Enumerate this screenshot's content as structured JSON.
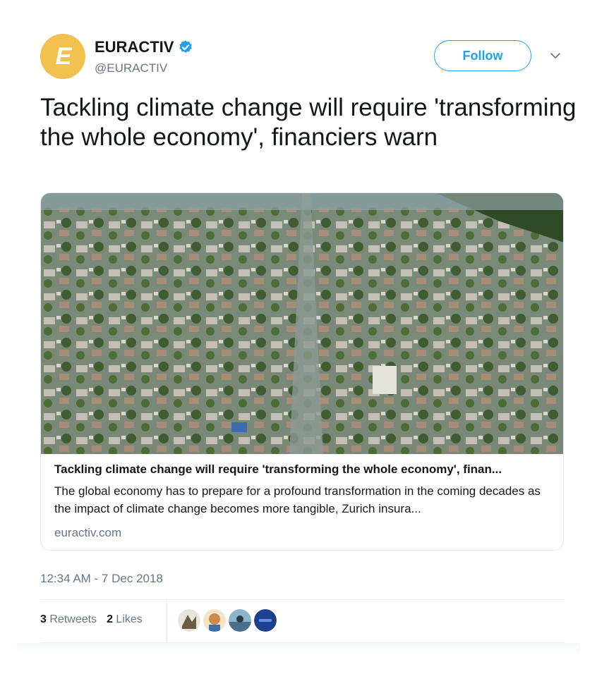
{
  "account": {
    "display_name": "EURACTIV",
    "handle": "@EURACTIV",
    "avatar_letter": "E",
    "verified": true,
    "avatar_color": "#f2c14e"
  },
  "actions": {
    "follow_label": "Follow"
  },
  "tweet": {
    "text": "Tackling climate change will require 'transforming the whole economy', financiers warn"
  },
  "card": {
    "title": "Tackling climate change will require 'transforming the whole economy', finan...",
    "description": "The global economy has to prepare for a profound transformation in the coming decades as the impact of climate change becomes more tangible, Zurich insura...",
    "domain": "euractiv.com",
    "image_subject": "aerial view of flooded residential neighborhood"
  },
  "meta": {
    "timestamp": "12:34 AM - 7 Dec 2018"
  },
  "stats": {
    "retweets_count": "3",
    "retweets_label": "Retweets",
    "likes_count": "2",
    "likes_label": "Likes"
  },
  "likers": [
    {
      "name": "liker-1",
      "color": "#6b5a44"
    },
    {
      "name": "liker-2",
      "color": "#c98a4a"
    },
    {
      "name": "liker-3",
      "color": "#4b6e8a"
    },
    {
      "name": "liker-4",
      "color": "#1d3f8f"
    }
  ],
  "colors": {
    "accent": "#1da1f2",
    "secondary_text": "#657786",
    "primary_text": "#14171a"
  }
}
